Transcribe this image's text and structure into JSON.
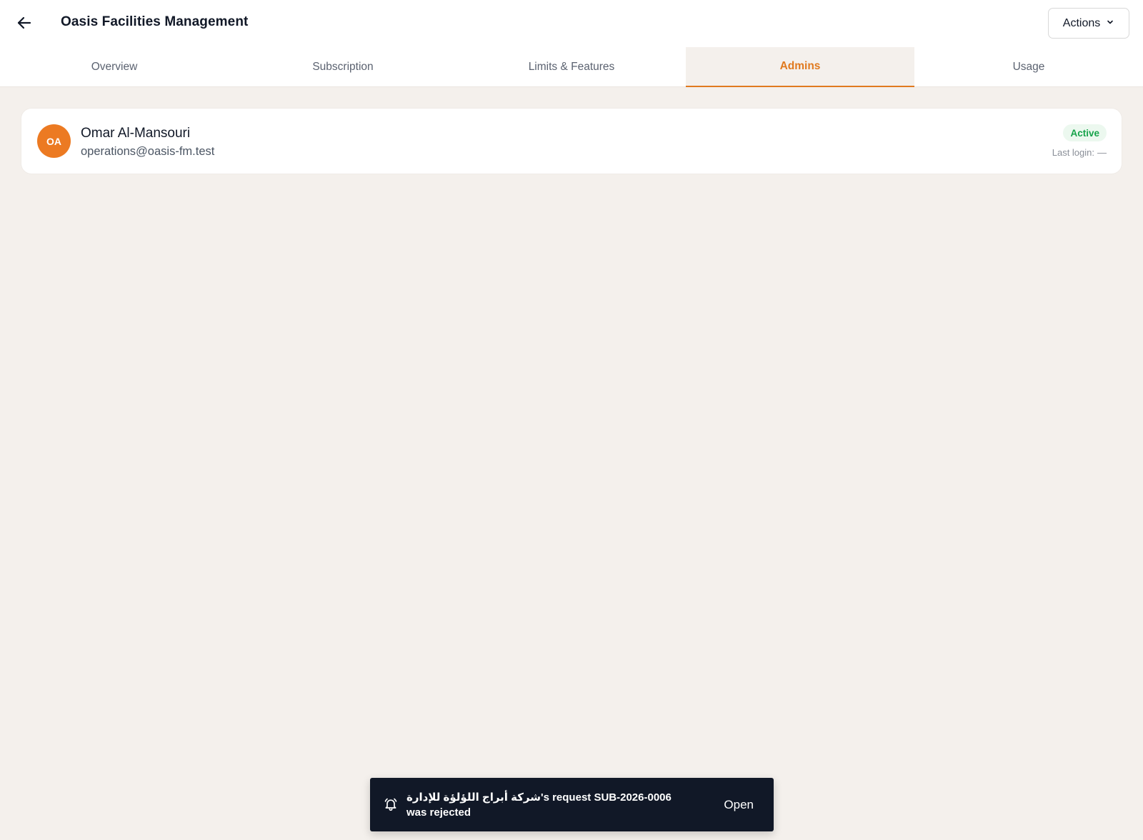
{
  "header": {
    "back_icon": "arrow-left-icon",
    "title": "Oasis Facilities Management",
    "actions_label": "Actions",
    "actions_icon": "chevron-down-icon"
  },
  "tabs": [
    {
      "label": "Overview",
      "active": false
    },
    {
      "label": "Subscription",
      "active": false
    },
    {
      "label": "Limits & Features",
      "active": false
    },
    {
      "label": "Admins",
      "active": true
    },
    {
      "label": "Usage",
      "active": false
    }
  ],
  "admins": [
    {
      "initials": "OA",
      "name": "Omar Al-Mansouri",
      "email": "operations@oasis-fm.test",
      "status": "Active",
      "last_login_label": "Last login:",
      "last_login_value": "—"
    }
  ],
  "toast": {
    "icon": "bell-icon",
    "message": "شركة أبراج اللؤلؤة للإدارة's request SUB-2026-0006 was rejected",
    "action_label": "Open"
  },
  "colors": {
    "accent": "#e07a1f",
    "avatar": "#ec7a22",
    "status_active": "#16a34a",
    "toast_bg": "#111827",
    "page_bg": "#f4f0ec"
  }
}
